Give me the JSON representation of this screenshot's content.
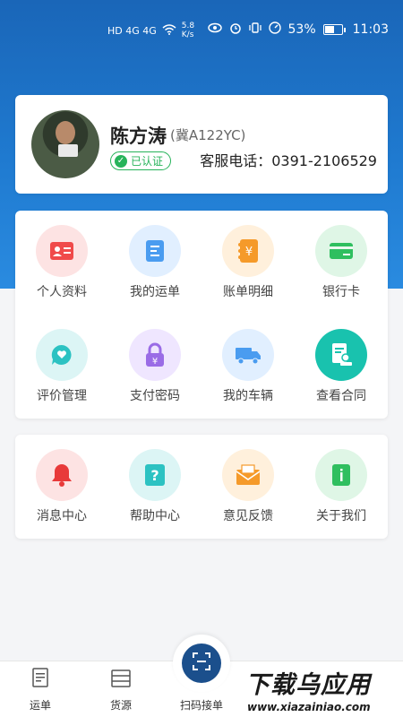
{
  "status_bar": {
    "network_left": "HD 4G 4G",
    "speed": "5.8 K/s",
    "battery": "53%",
    "time": "11:03"
  },
  "profile": {
    "name": "陈方涛",
    "plate": "(冀A122YC)",
    "verified": "已认证",
    "service_phone": "客服电话：0391-2106529"
  },
  "menu": [
    {
      "label": "个人资料",
      "icon": "id-card-icon",
      "bg": "#fde3e3",
      "color": "#f04a4a"
    },
    {
      "label": "我的运单",
      "icon": "waybill-icon",
      "bg": "#e1efff",
      "color": "#4a9cf0"
    },
    {
      "label": "账单明细",
      "icon": "bill-icon",
      "bg": "#fff0dc",
      "color": "#f59a2a"
    },
    {
      "label": "银行卡",
      "icon": "bank-card-icon",
      "bg": "#dff6e6",
      "color": "#2fbf5f"
    },
    {
      "label": "评价管理",
      "icon": "review-icon",
      "bg": "#dcf5f5",
      "color": "#2cc2c2"
    },
    {
      "label": "支付密码",
      "icon": "lock-icon",
      "bg": "#efe6ff",
      "color": "#9a6ce6"
    },
    {
      "label": "我的车辆",
      "icon": "truck-icon",
      "bg": "#e1efff",
      "color": "#4a9cf0"
    },
    {
      "label": "查看合同",
      "icon": "contract-icon",
      "bg": "#dcf5f5",
      "color": "#19c2ae"
    }
  ],
  "menu2": [
    {
      "label": "消息中心",
      "icon": "bell-icon",
      "bg": "#fde3e3",
      "color": "#e83a3a"
    },
    {
      "label": "帮助中心",
      "icon": "help-icon",
      "bg": "#dcf5f5",
      "color": "#2cc2c2"
    },
    {
      "label": "意见反馈",
      "icon": "feedback-icon",
      "bg": "#fff0dc",
      "color": "#f59a2a"
    },
    {
      "label": "关于我们",
      "icon": "info-icon",
      "bg": "#dff6e6",
      "color": "#2fbf5f"
    }
  ],
  "tabs": {
    "waybill": "运单",
    "cargo": "货源",
    "scan": "扫码接单"
  },
  "watermark": {
    "title": "下载乌应用",
    "url": "www.xiazainiao.com"
  }
}
